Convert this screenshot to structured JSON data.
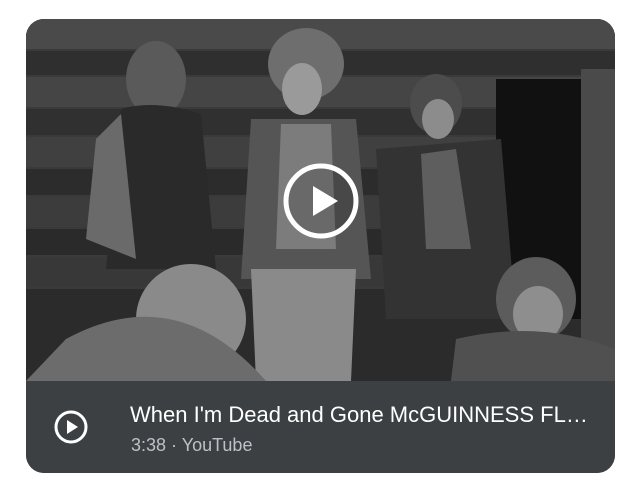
{
  "video": {
    "title": "When I'm Dead and Gone McGUINNESS FLINT",
    "duration": "3:38",
    "separator": " · ",
    "source": "YouTube",
    "play_icon": "play-icon",
    "small_play_icon": "play-circle-icon"
  }
}
